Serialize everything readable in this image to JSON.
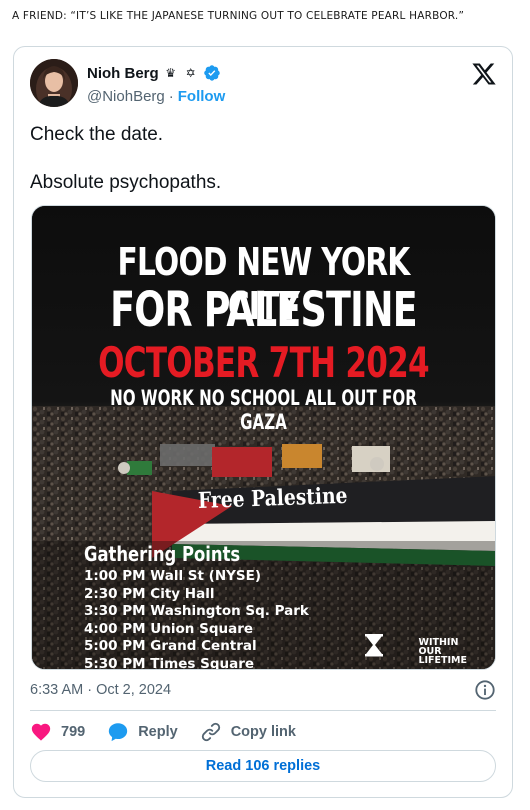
{
  "caption": "A FRIEND: “IT’S LIKE THE JAPANESE TURNING OUT TO CELEBRATE PEARL HARBOR.”",
  "tweet": {
    "author": {
      "display_name": "Nioh Berg",
      "badges": [
        "crown-glyph",
        "star-of-david-glyph",
        "verified-badge"
      ],
      "handle": "@NiohBerg",
      "separator": "·",
      "follow_label": "Follow"
    },
    "platform_icon": "x-logo",
    "text": [
      "Check the date.",
      "Absolute psychopaths."
    ],
    "media": {
      "headline_1": "FLOOD NEW YORK CITY",
      "headline_2": "FOR PALESTINE",
      "headline_3": "OCTOBER 7TH 2024",
      "headline_4": "NO WORK  NO SCHOOL  ALL OUT FOR GAZA",
      "banner_text": "Free Palestine",
      "gathering_title": "Gathering Points",
      "gathering_points": [
        "1:00 PM Wall St (NYSE)",
        "2:30 PM City Hall",
        "3:30 PM Washington Sq. Park",
        "4:00 PM Union Square",
        "5:00 PM Grand Central",
        "5:30 PM Times Square"
      ],
      "org_logo": [
        "WITHIN",
        "OUR",
        "LIFETIME"
      ],
      "colors": {
        "headline_red": "#e51b23",
        "headline_white": "#ffffff"
      }
    },
    "timestamp": "6:33 AM · Oct 2, 2024",
    "actions": {
      "like_count": "799",
      "reply_label": "Reply",
      "copy_link_label": "Copy link"
    },
    "read_replies_label": "Read 106 replies"
  },
  "colors": {
    "accent": "#1d9bf0",
    "link_dark": "#006fd6",
    "like": "#f91880",
    "muted": "#536471",
    "border": "#cfd9de"
  }
}
